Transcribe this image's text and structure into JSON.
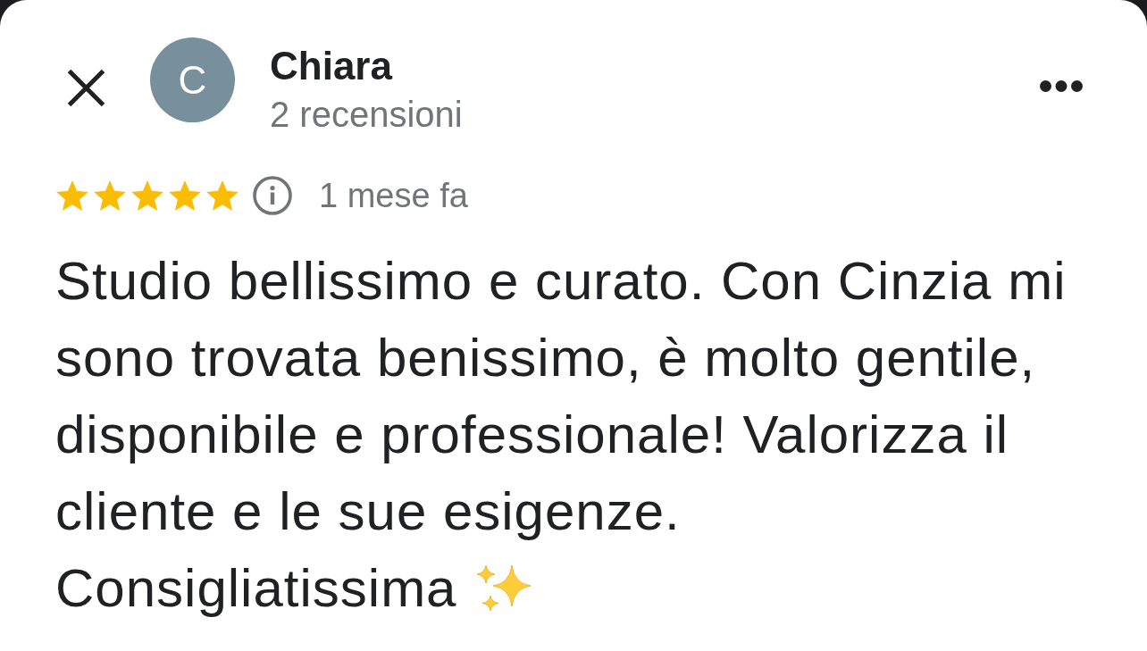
{
  "reviewer": {
    "avatar_letter": "C",
    "name": "Chiara",
    "review_count": "2 recensioni"
  },
  "review": {
    "stars": 5,
    "time": "1 mese fa",
    "paragraphs": [
      "Studio bellissimo e curato. Con Cinzia mi sono trovata benissimo, è molto gentile, disponibile e professionale! Valorizza il cliente e le sue esigenze.",
      "Consigliatissima"
    ]
  }
}
